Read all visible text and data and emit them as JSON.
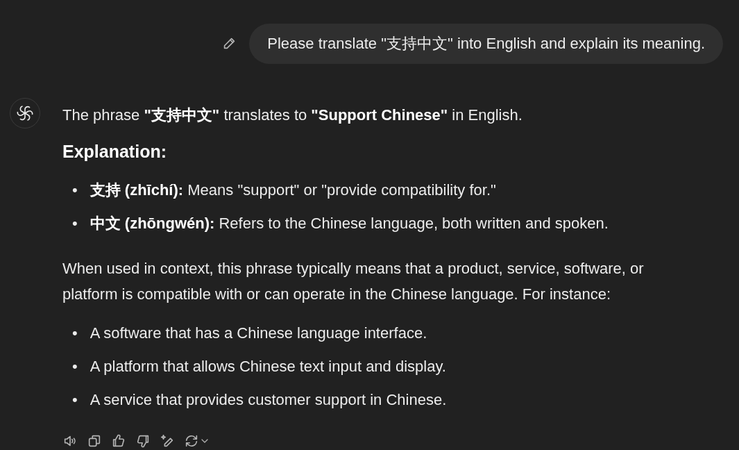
{
  "user_message": {
    "text": "Please translate \"支持中文\" into English and explain its meaning."
  },
  "assistant_message": {
    "blocks": [
      {
        "kind": "paragraph",
        "text": "The phrase **\"支持中文\"** translates to **\"Support Chinese\"** in English."
      },
      {
        "kind": "heading",
        "text": "Explanation:"
      },
      {
        "kind": "bullets",
        "items": [
          {
            "marker": "•",
            "text": "**支持 (zhīchí):** Means \"support\" or \"provide compatibility for.\""
          },
          {
            "marker": "•",
            "text": "**中文 (zhōngwén):** Refers to the Chinese language, both written and spoken."
          }
        ]
      },
      {
        "kind": "paragraph",
        "text": "When used in context, this phrase typically means that a product, service, software, or platform is compatible with or can operate in the Chinese language. For instance:"
      },
      {
        "kind": "bullets",
        "items": [
          {
            "marker": "•",
            "text": "A software that has a Chinese language interface."
          },
          {
            "marker": "•",
            "text": "A platform that allows Chinese text input and display."
          },
          {
            "marker": "•",
            "text": "A service that provides customer support in Chinese."
          }
        ]
      }
    ]
  }
}
